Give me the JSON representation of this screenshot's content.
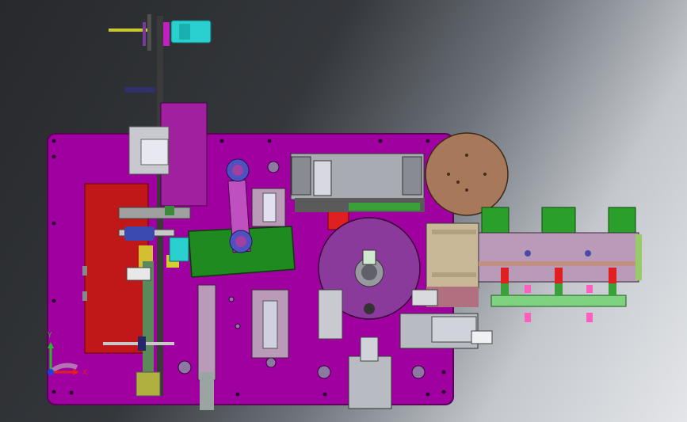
{
  "viewport": {
    "background_dark": "#2a2c2f",
    "background_light": "#e4e6e9"
  },
  "colors": {
    "baseplate": "#a000a0",
    "baseplate_edge": "#5a005a",
    "red_plate": "#c01818",
    "green_plate": "#1f8a1f",
    "rotary_disc": "#8a3a9a",
    "cam_wheel": "#a8785a",
    "lavender": "#b99ab8",
    "mint": "#7fd27f",
    "cyan": "#2ad0d0",
    "steel": "#b8bcc2",
    "olive": "#9a9a30"
  },
  "triad": {
    "x_label": "X",
    "y_label": "Y",
    "x_color": "#e02020",
    "y_color": "#20c020",
    "z_color": "#2040e0"
  }
}
